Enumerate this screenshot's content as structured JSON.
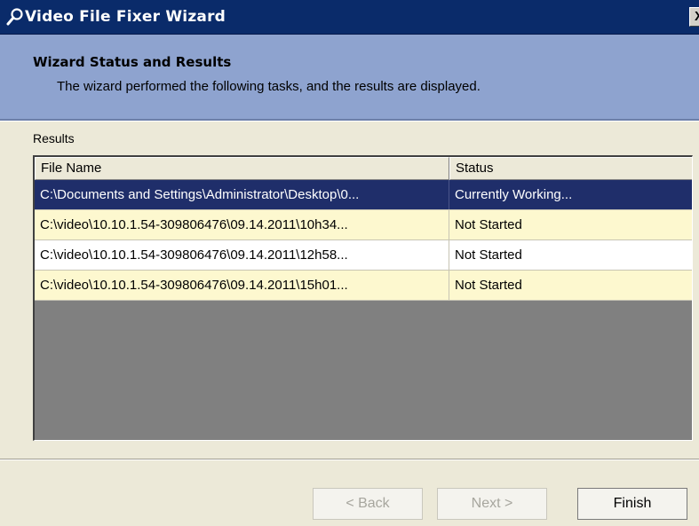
{
  "window": {
    "title": "Video File Fixer Wizard",
    "close_label": "X"
  },
  "header": {
    "title": "Wizard Status and Results",
    "subtitle": "The wizard performed the following tasks, and the results are displayed."
  },
  "results": {
    "label": "Results",
    "columns": [
      "File Name",
      "Status"
    ],
    "rows": [
      {
        "file": "C:\\Documents and Settings\\Administrator\\Desktop\\0...",
        "status": "Currently Working..."
      },
      {
        "file": "C:\\video\\10.10.1.54-309806476\\09.14.2011\\10h34...",
        "status": "Not Started"
      },
      {
        "file": "C:\\video\\10.10.1.54-309806476\\09.14.2011\\12h58...",
        "status": "Not Started"
      },
      {
        "file": "C:\\video\\10.10.1.54-309806476\\09.14.2011\\15h01...",
        "status": "Not Started"
      }
    ]
  },
  "buttons": {
    "back": "< Back",
    "next": "Next >",
    "finish": "Finish"
  },
  "colors": {
    "titlebar": "#0a2b6a",
    "header": "#8ea3cf",
    "selected_row": "#1f2e6a",
    "alt_row": "#fdf8cf"
  },
  "icons": {
    "title_icon": "magnifier-wrench-icon"
  }
}
